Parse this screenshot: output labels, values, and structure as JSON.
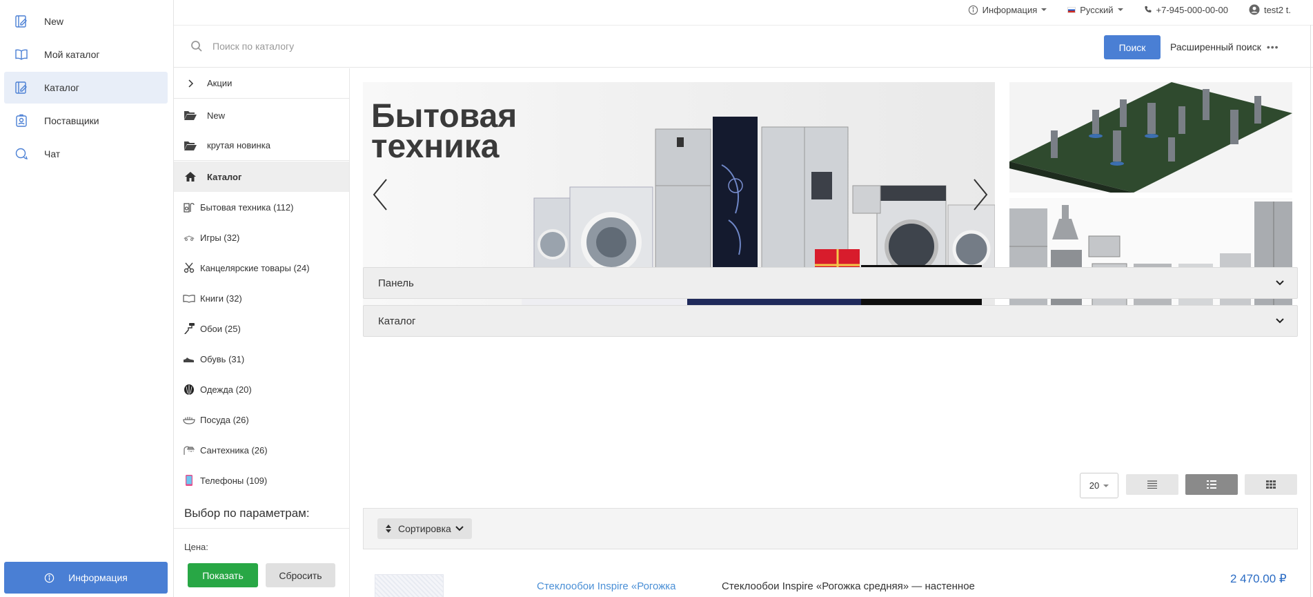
{
  "leftnav": {
    "items": [
      {
        "label": "New",
        "icon": "catalog-edit-icon",
        "active": false
      },
      {
        "label": "Мой каталог",
        "icon": "book-icon",
        "active": false
      },
      {
        "label": "Каталог",
        "icon": "catalog-edit-icon",
        "active": true
      },
      {
        "label": "Поставщики",
        "icon": "badge-icon",
        "active": false
      },
      {
        "label": "Чат",
        "icon": "chat-icon",
        "active": false
      }
    ],
    "info_button": "Информация"
  },
  "topbar": {
    "info": "Информация",
    "language": "Русский",
    "phone": "+7-945-000-00-00",
    "user": "test2 t."
  },
  "search": {
    "placeholder": "Поиск по каталогу",
    "button": "Поиск",
    "advanced": "Расширенный поиск",
    "advanced_dots": "•••"
  },
  "catbar": {
    "promo": "Акции",
    "folders": [
      "New",
      "крутая новинка"
    ],
    "catalog": "Каталог",
    "categories": [
      {
        "label": "Бытовая техника (112)",
        "icon": "appliance-icon"
      },
      {
        "label": "Игры (32)",
        "icon": "game-icon"
      },
      {
        "label": "Канцелярские товары (24)",
        "icon": "stationery-icon"
      },
      {
        "label": "Книги (32)",
        "icon": "book-icon"
      },
      {
        "label": "Обои (25)",
        "icon": "roller-icon"
      },
      {
        "label": "Обувь (31)",
        "icon": "shoe-icon"
      },
      {
        "label": "Одежда (20)",
        "icon": "clothes-icon"
      },
      {
        "label": "Посуда (26)",
        "icon": "dishes-icon"
      },
      {
        "label": "Сантехника (26)",
        "icon": "shower-icon"
      },
      {
        "label": "Телефоны (109)",
        "icon": "phone-device-icon"
      }
    ],
    "params_title": "Выбор по параметрам:",
    "price_label": "Цена:",
    "show_button": "Показать",
    "reset_button": "Сбросить"
  },
  "main": {
    "banner_title_line1": "Бытовая",
    "banner_title_line2": "техника",
    "accordion_panel": "Панель",
    "accordion_catalog": "Каталог",
    "per_page": "20",
    "sort_label": "Сортировка",
    "product": {
      "name": "Стеклообои Inspire «Рогожка",
      "description": "Стеклообои Inspire «Рогожка средняя» — настенное",
      "price": "2 470.00 ₽"
    }
  },
  "colors": {
    "primary": "#4a7fd4",
    "success": "#28a745",
    "active_bg": "#e8eef8",
    "price": "#2b6cc4"
  }
}
